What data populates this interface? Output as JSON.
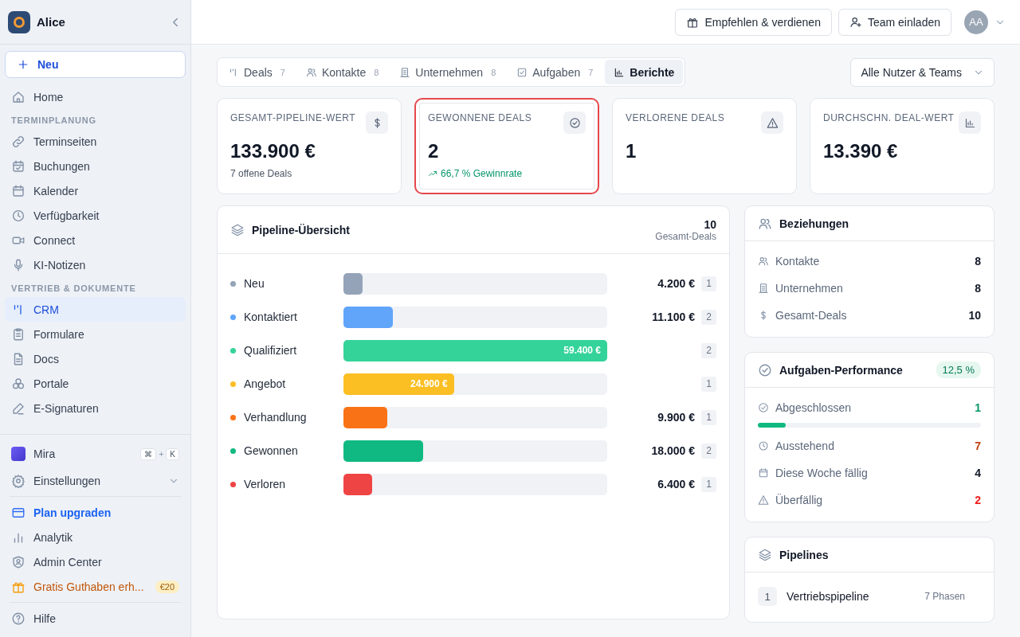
{
  "sidebar": {
    "workspace": "Alice",
    "new_button": "Neu",
    "items": [
      {
        "kind": "item",
        "label": "Home",
        "selected": false
      },
      {
        "kind": "section",
        "label": "TERMINPLANUNG"
      },
      {
        "kind": "item",
        "label": "Terminseiten",
        "selected": false
      },
      {
        "kind": "item",
        "label": "Buchungen",
        "selected": false
      },
      {
        "kind": "item",
        "label": "Kalender",
        "selected": false
      },
      {
        "kind": "item",
        "label": "Verfügbarkeit",
        "selected": false
      },
      {
        "kind": "item",
        "label": "Connect",
        "selected": false
      },
      {
        "kind": "item",
        "label": "KI-Notizen",
        "selected": false
      },
      {
        "kind": "section",
        "label": "VERTRIEB & DOKUMENTE"
      },
      {
        "kind": "item",
        "label": "CRM",
        "selected": true
      },
      {
        "kind": "item",
        "label": "Formulare",
        "selected": false
      },
      {
        "kind": "item",
        "label": "Docs",
        "selected": false
      },
      {
        "kind": "item",
        "label": "Portale",
        "selected": false
      },
      {
        "kind": "item",
        "label": "E-Signaturen",
        "selected": false
      }
    ],
    "assistant": {
      "label": "Mira",
      "keys": [
        "⌘",
        "+",
        "K"
      ]
    },
    "settings": {
      "label": "Einstellungen",
      "expanded": false
    },
    "links": [
      {
        "kind": "upgrade",
        "label": "Plan upgraden"
      },
      {
        "kind": "plain",
        "label": "Analytik"
      },
      {
        "kind": "plain",
        "label": "Admin Center"
      },
      {
        "kind": "promo",
        "label": "Gratis Guthaben erh...",
        "badge": "€20"
      }
    ],
    "help": "Hilfe"
  },
  "topbar": {
    "buttons": [
      "Empfehlen & verdienen",
      "Team einladen"
    ],
    "avatar": "AA"
  },
  "tabs": [
    {
      "label": "Deals",
      "count": "7",
      "selected": false
    },
    {
      "label": "Kontakte",
      "count": "8",
      "selected": false
    },
    {
      "label": "Unternehmen",
      "count": "8",
      "selected": false
    },
    {
      "label": "Aufgaben",
      "count": "7",
      "selected": false
    },
    {
      "label": "Berichte",
      "selected": true
    }
  ],
  "filter": "Alle Nutzer & Teams",
  "stats": [
    {
      "label": "GESAMT-PIPELINE-WERT",
      "value": "133.900 €",
      "note": "7 offene Deals",
      "trend": false,
      "highlighted": false
    },
    {
      "label": "GEWONNENE DEALS",
      "value": "2",
      "note": "66,7 % Gewinnrate",
      "trend": true,
      "highlighted": true
    },
    {
      "label": "VERLORENE DEALS",
      "value": "1",
      "highlighted": false
    },
    {
      "label": "DURCHSCHN. DEAL-WERT",
      "value": "13.390 €",
      "highlighted": false
    }
  ],
  "pipeline": {
    "title": "Pipeline-Übersicht",
    "total": "10",
    "total_label": "Gesamt-Deals",
    "stages": [
      {
        "name": "Neu",
        "color": "#94a3b8",
        "level": 0.071,
        "amount": "4.200 €",
        "amount_inside": false,
        "count": "1"
      },
      {
        "name": "Kontaktiert",
        "color": "#60a5fa",
        "level": 0.187,
        "amount": "11.100 €",
        "amount_inside": false,
        "count": "2"
      },
      {
        "name": "Qualifiziert",
        "color": "#34d399",
        "level": 1,
        "amount": "59.400 €",
        "amount_inside": true,
        "count": "2"
      },
      {
        "name": "Angebot",
        "color": "#fbbf24",
        "level": 0.419,
        "amount": "24.900 €",
        "amount_inside": true,
        "count": "1"
      },
      {
        "name": "Verhandlung",
        "color": "#f97316",
        "level": 0.167,
        "amount": "9.900 €",
        "amount_inside": false,
        "count": "1"
      },
      {
        "name": "Gewonnen",
        "color": "#10b981",
        "level": 0.303,
        "amount": "18.000 €",
        "amount_inside": false,
        "count": "2"
      },
      {
        "name": "Verloren",
        "color": "#ef4444",
        "level": 0.108,
        "amount": "6.400 €",
        "amount_inside": false,
        "count": "1"
      }
    ]
  },
  "relations": {
    "title": "Beziehungen",
    "rows": [
      {
        "label": "Kontakte",
        "value": "8"
      },
      {
        "label": "Unternehmen",
        "value": "8"
      },
      {
        "label": "Gesamt-Deals",
        "value": "10"
      }
    ]
  },
  "tasks": {
    "title": "Aufgaben-Performance",
    "rate": "12,5 %",
    "level": 0.125,
    "rows": [
      {
        "label": "Abgeschlossen",
        "value": "1",
        "color": "#059669"
      },
      {
        "label": "Ausstehend",
        "value": "7",
        "color": "#c2410c"
      },
      {
        "label": "Diese Woche fällig",
        "value": "4",
        "color": "#111827"
      },
      {
        "label": "Überfällig",
        "value": "2",
        "color": "#ef1c1c"
      }
    ]
  },
  "pipelines": {
    "title": "Pipelines",
    "rows": [
      {
        "index": "1",
        "name": "Vertriebspipeline",
        "phases": "7 Phasen"
      }
    ]
  }
}
